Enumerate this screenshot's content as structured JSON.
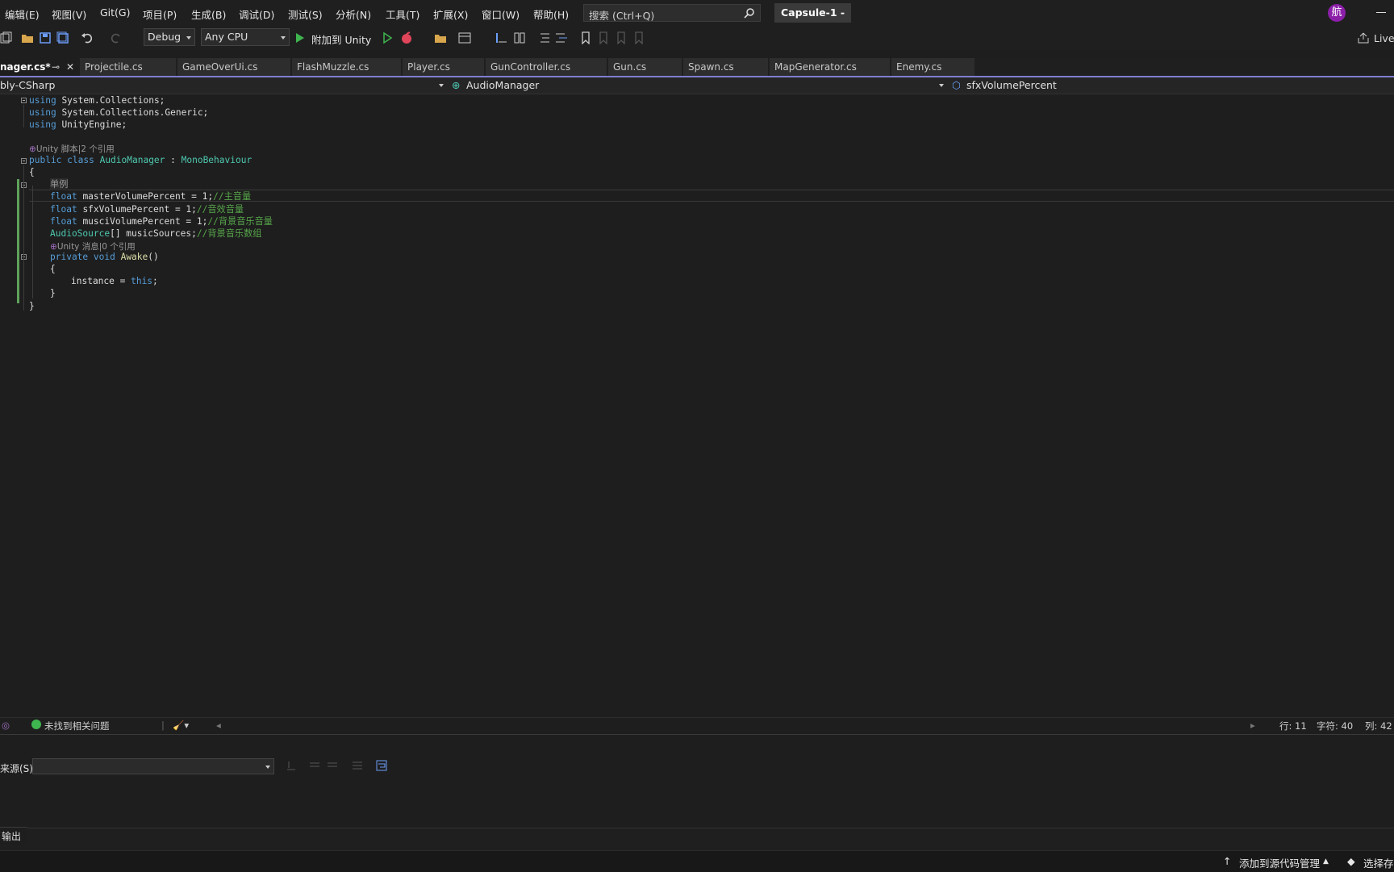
{
  "menu": [
    "编辑(E)",
    "视图(V)",
    "Git(G)",
    "项目(P)",
    "生成(B)",
    "调试(D)",
    "测试(S)",
    "分析(N)",
    "工具(T)",
    "扩展(X)",
    "窗口(W)",
    "帮助(H)"
  ],
  "search": {
    "placeholder": "搜索 (Ctrl+Q)"
  },
  "project_name": "Capsule-1 -",
  "avatar_initial": "航",
  "toolbar": {
    "configuration": "Debug",
    "platform": "Any CPU",
    "attach": "附加到 Unity",
    "live_share": "Live"
  },
  "tabs": [
    {
      "label": "nager.cs*",
      "active": true
    },
    {
      "label": "Projectile.cs"
    },
    {
      "label": "GameOverUi.cs"
    },
    {
      "label": "FlashMuzzle.cs"
    },
    {
      "label": "Player.cs"
    },
    {
      "label": "GunController.cs"
    },
    {
      "label": "Gun.cs"
    },
    {
      "label": "Spawn.cs"
    },
    {
      "label": "MapGenerator.cs"
    },
    {
      "label": "Enemy.cs"
    }
  ],
  "nav": {
    "project": "bly-CSharp",
    "type": "AudioManager",
    "member": "sfxVolumePercent"
  },
  "code": {
    "l1": "System.Collections;",
    "l2": "System.Collections.Generic;",
    "l3": "UnityEngine;",
    "lens1": "Unity 脚本|2 个引用",
    "class_decl_name": "AudioManager",
    "base_class": "MonoBehaviour",
    "region": "单例",
    "master": "masterVolumePercent = 1;",
    "master_comment": "//主音量",
    "sfx": "sfxVolumePercent = 1;",
    "sfx_comment": "//音效音量",
    "music": "musciVolumePercent = 1;",
    "music_comment": "//背景音乐音量",
    "sources_type": "AudioSource",
    "sources": "[] musicSources;",
    "sources_comment": "//背景音乐数组",
    "lens2": "Unity 消息|0 个引用",
    "awake": "Awake",
    "instance": "instance = ",
    "this_kw": "this",
    "semicolon": ";"
  },
  "editor_status": {
    "issues": "未找到相关问题",
    "line": "行: 11",
    "char": "字符: 40",
    "col": "列: 42"
  },
  "output": {
    "source_label": "来源(S):",
    "tab": "输出"
  },
  "statusbar": {
    "source_control": "添加到源代码管理",
    "select_repo": "选择存"
  },
  "colors": {
    "accent": "#7f7fd1",
    "keyword": "#569cd6",
    "type": "#4ec9b0",
    "comment": "#57a64a",
    "changed": "#5ea35a"
  }
}
